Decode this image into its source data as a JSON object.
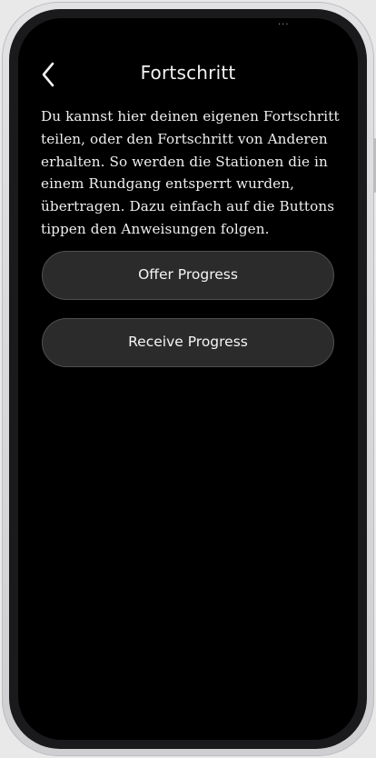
{
  "header": {
    "title": "Fortschritt",
    "back_icon": "chevron-left-icon"
  },
  "description": "Du kannst hier deinen eigenen Fortschritt teilen, oder den Fortschritt von Anderen erhalten. So werden die Stationen die in einem Rundgang entsperrt wurden, übertragen. Dazu einfach auf die Buttons tippen den Anweisungen folgen.",
  "actions": {
    "offer_label": "Offer Progress",
    "receive_label": "Receive Progress"
  },
  "colors": {
    "background": "#000000",
    "button_fill": "#2b2b2b",
    "button_border": "#4f4f4f",
    "text": "#f2f2f2",
    "device_frame": "#d8d8da"
  }
}
